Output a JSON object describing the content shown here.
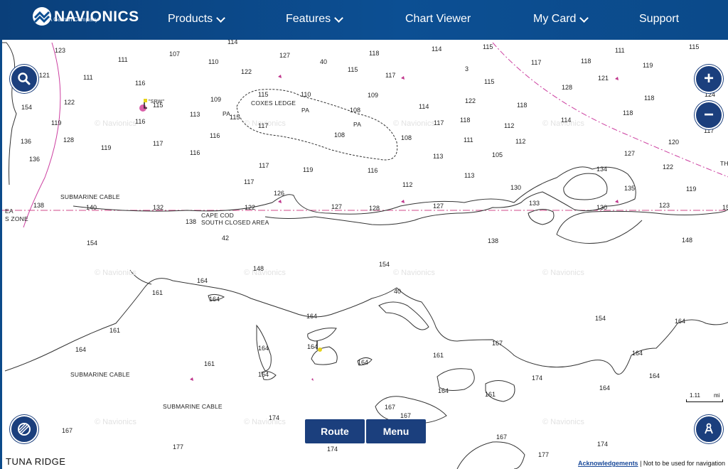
{
  "brand": {
    "name": "NAVIONICS",
    "tagline": "A Garmin Company"
  },
  "nav": [
    {
      "label": "Products",
      "dropdown": true
    },
    {
      "label": "Features",
      "dropdown": true
    },
    {
      "label": "Chart Viewer",
      "dropdown": false
    },
    {
      "label": "My Card",
      "dropdown": true
    },
    {
      "label": "Support",
      "dropdown": false
    }
  ],
  "map": {
    "buttons": {
      "search": "search-icon",
      "zoom_in": "+",
      "zoom_out": "−",
      "layers": "layers-icon",
      "settings": "advanced-options-icon"
    },
    "zoom_indicator": "124",
    "route_label": "Route",
    "menu_label": "Menu",
    "place_name": "TUNA RIDGE",
    "scale": {
      "value": "1.11",
      "unit": "mi"
    },
    "watermark": "© Navionics",
    "labels": {
      "coxes_ledge": "COXES LEDGE",
      "submarine_cable": "SUBMARINE CABLE",
      "cape_cod_1": "CAPE COD",
      "cape_cod_2": "SOUTH CLOSED AREA",
      "zone_a": "EA",
      "zone_b": "S ZONE",
      "pa": "PA",
      "srw": "\"SRW\"",
      "th": "TH"
    },
    "depths": [
      "123",
      "111",
      "107",
      "110",
      "114",
      "127",
      "40",
      "118",
      "114",
      "115",
      "117",
      "118",
      "111",
      "115",
      "3",
      "121",
      "111",
      "116",
      "122",
      "115",
      "117",
      "115",
      "128",
      "121",
      "119",
      "154",
      "122",
      "115",
      "109",
      "115",
      "110",
      "109",
      "108",
      "114",
      "122",
      "118",
      "118",
      "124",
      "119",
      "116",
      "113",
      "115",
      "117",
      "118",
      "112",
      "114",
      "118",
      "117",
      "136",
      "128",
      "119",
      "117",
      "116",
      "108",
      "108",
      "111",
      "112",
      "120",
      "117",
      "116",
      "105",
      "136",
      "117",
      "119",
      "116",
      "113",
      "113",
      "127",
      "122",
      "117",
      "126",
      "112",
      "134",
      "130",
      "135",
      "119",
      "138",
      "140",
      "132",
      "122",
      "127",
      "128",
      "127",
      "133",
      "130",
      "123",
      "15",
      "138",
      "42",
      "154",
      "138",
      "148",
      "148",
      "154",
      "164",
      "161",
      "164",
      "40",
      "164",
      "154",
      "161",
      "164",
      "164",
      "164",
      "164",
      "167",
      "164",
      "161",
      "164",
      "161",
      "164",
      "174",
      "164",
      "164",
      "164",
      "161",
      "167",
      "167",
      "174",
      "167",
      "177",
      "174"
    ],
    "footer": {
      "link": "Acknowledgements",
      "text": " | Not to be used for navigation"
    }
  }
}
